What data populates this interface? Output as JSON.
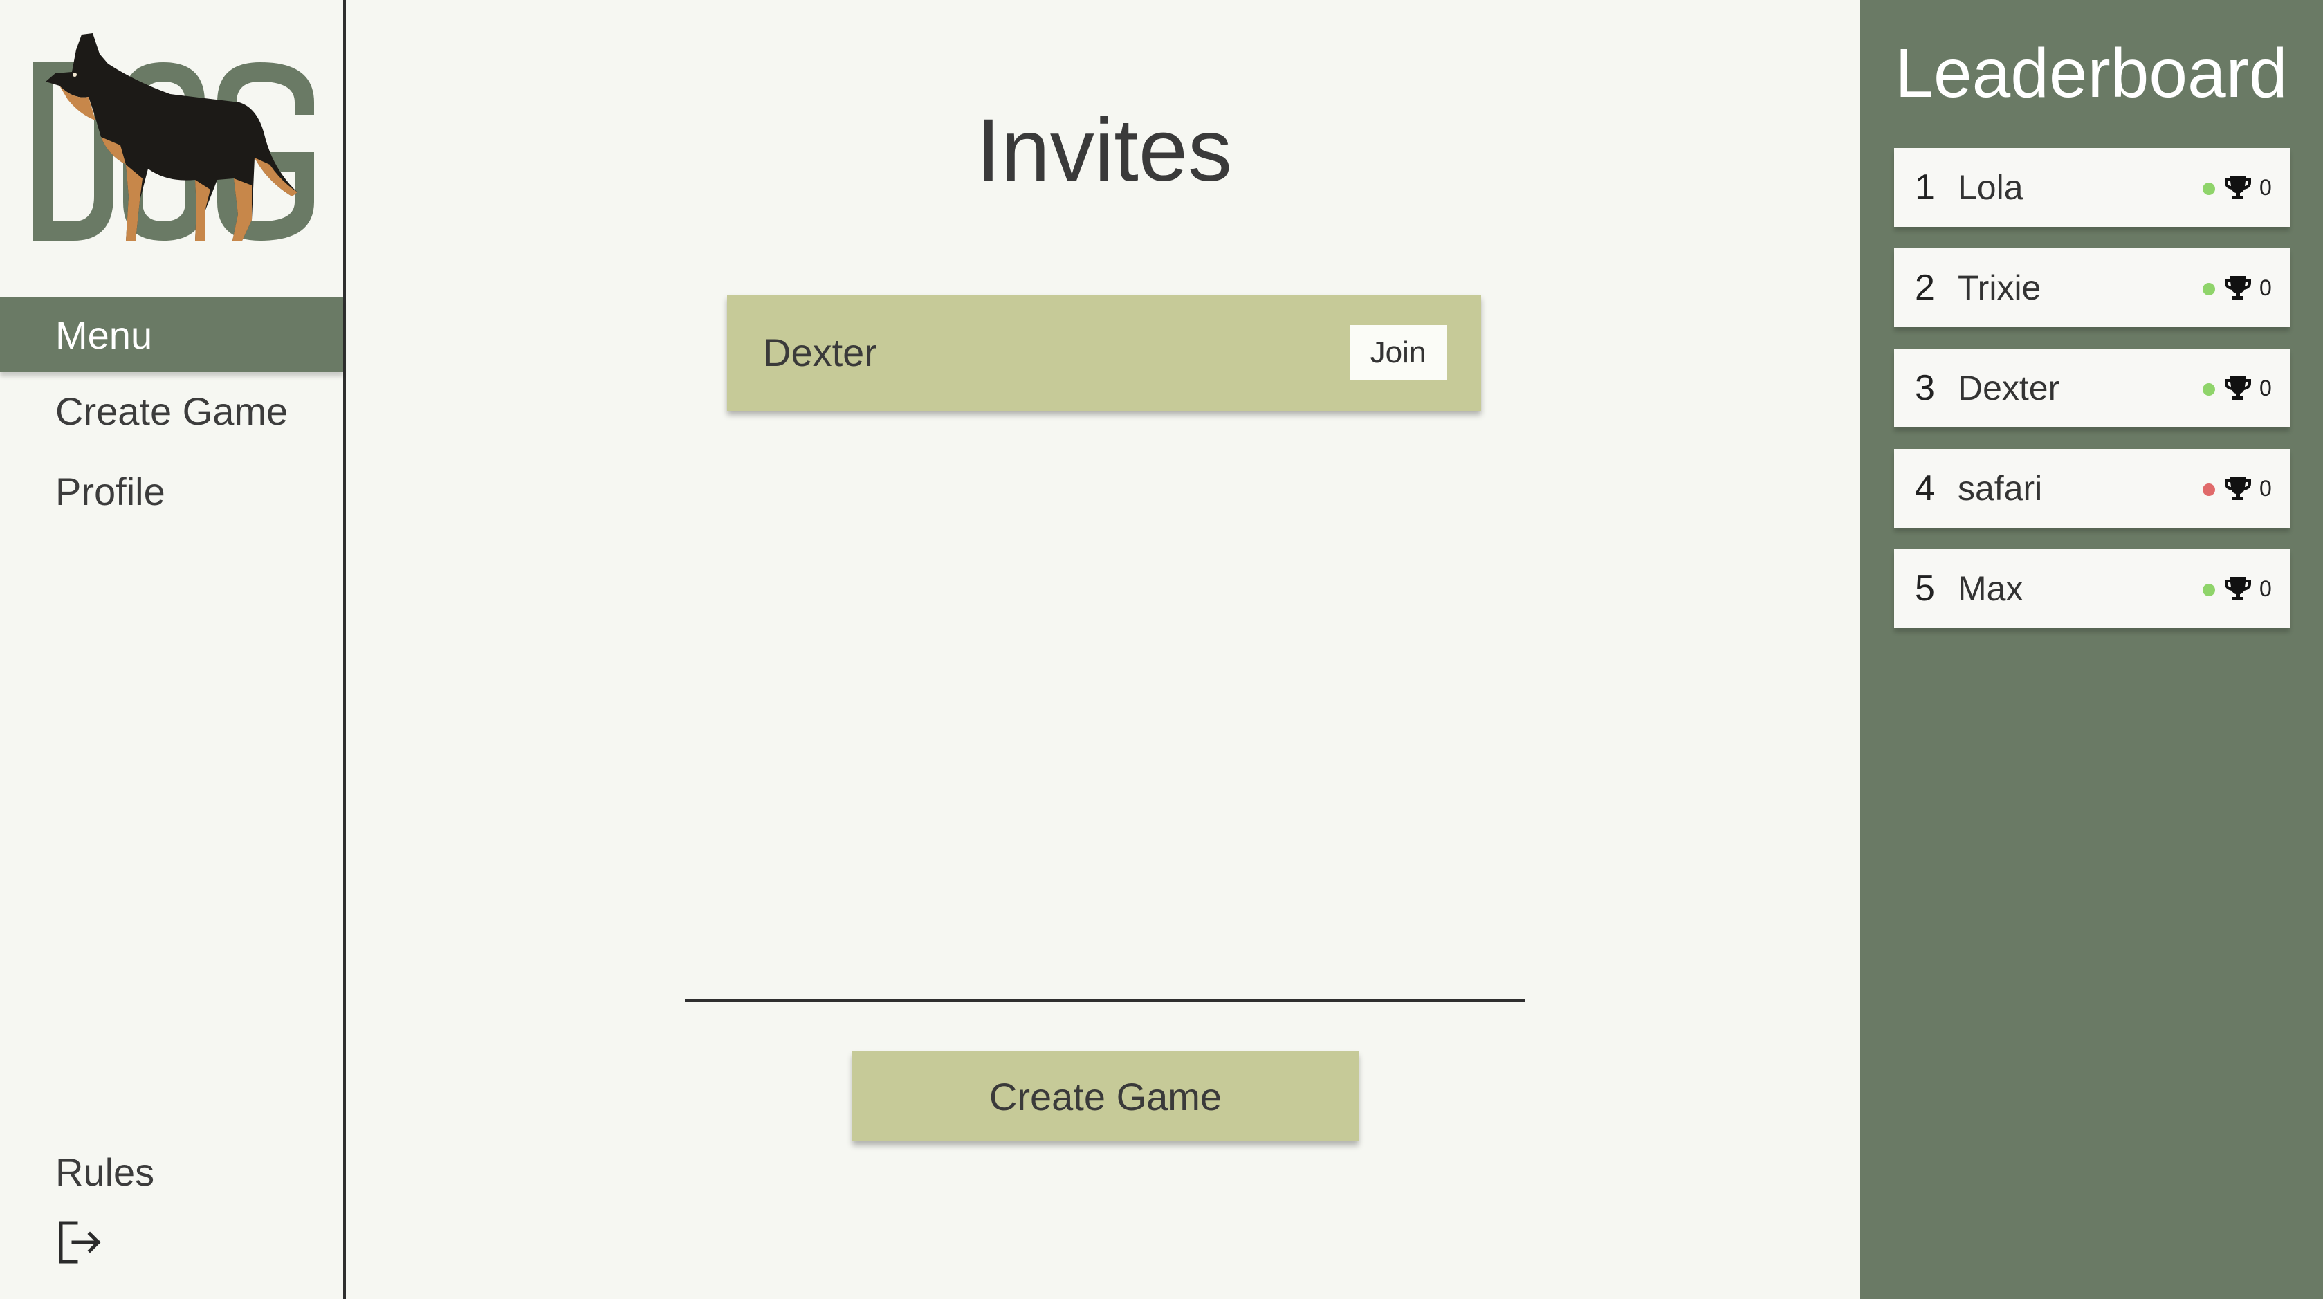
{
  "logo": {
    "text": "DOG"
  },
  "sidebar": {
    "items": [
      {
        "label": "Menu",
        "active": true
      },
      {
        "label": "Create Game",
        "active": false
      },
      {
        "label": "Profile",
        "active": false
      }
    ],
    "rules_label": "Rules",
    "logout_icon": "logout-icon"
  },
  "main": {
    "title": "Invites",
    "invites": [
      {
        "name": "Dexter",
        "join_label": "Join"
      }
    ],
    "create_game_label": "Create Game"
  },
  "leaderboard": {
    "title": "Leaderboard",
    "entries": [
      {
        "rank": "1",
        "name": "Lola",
        "status": "online",
        "status_color": "#8fd46a",
        "score": "0"
      },
      {
        "rank": "2",
        "name": "Trixie",
        "status": "online",
        "status_color": "#8fd46a",
        "score": "0"
      },
      {
        "rank": "3",
        "name": "Dexter",
        "status": "online",
        "status_color": "#8fd46a",
        "score": "0"
      },
      {
        "rank": "4",
        "name": "safari",
        "status": "offline",
        "status_color": "#e06a6a",
        "score": "0"
      },
      {
        "rank": "5",
        "name": "Max",
        "status": "online",
        "status_color": "#8fd46a",
        "score": "0"
      }
    ]
  },
  "colors": {
    "background": "#f6f7f2",
    "accent_green": "#6a7a65",
    "card_khaki": "#c6ca98",
    "online": "#8fd46a",
    "offline": "#e06a6a"
  }
}
